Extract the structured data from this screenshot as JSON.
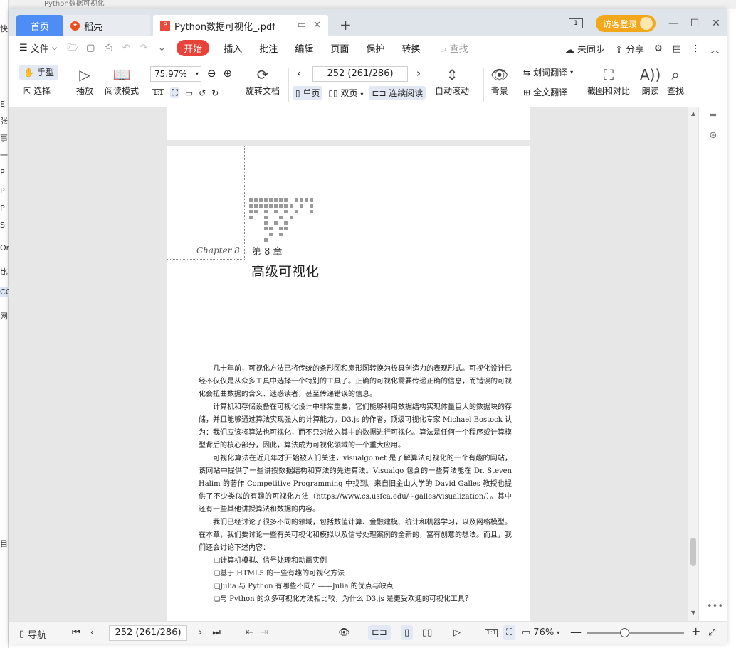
{
  "background_window": {
    "title": "Python数据可视化",
    "side_chars": [
      "快",
      "E",
      "张",
      "事",
      "一",
      "P",
      "P",
      "P",
      "S",
      "Or",
      "比",
      "CO",
      "网",
      "目"
    ]
  },
  "tabs": {
    "home": "首页",
    "docer": "稻壳",
    "pdf": "Python数据可视化_.pdf",
    "pdf_icon": "P",
    "add": "+"
  },
  "titlebar": {
    "guest_login": "访客登录",
    "pages_icon": "1"
  },
  "menu": {
    "file": "文件",
    "start": "开始",
    "items": [
      "插入",
      "批注",
      "编辑",
      "页面",
      "保护",
      "转换"
    ],
    "search": "查找",
    "unsynced": "未同步",
    "share": "分享"
  },
  "ribbon": {
    "hand": "手型",
    "select": "选择",
    "play": "播放",
    "read_mode": "阅读模式",
    "zoom": "75.97%",
    "rotate_doc": "旋转文档",
    "page_value": "252 (261/286)",
    "single_page": "单页",
    "double_page": "双页",
    "continuous": "连续阅读",
    "auto_scroll": "自动滚动",
    "background": "背景",
    "word_translate": "划词翻译",
    "full_translate": "全文翻译",
    "screenshot_compare": "截图和对比",
    "read_aloud": "朗读",
    "find": "查找",
    "actual_size": "1:1"
  },
  "document": {
    "chapter_script": "Chapter 8",
    "chapter_num": "第 8 章",
    "chapter_title": "高级可视化",
    "paragraphs": [
      "几十年前，可视化方法已将传统的条形图和扇形图转换为极具创造力的表现形式。可视化设计已经不仅仅是从众多工具中选择一个特别的工具了。正确的可视化需要传递正确的信息，而错误的可视化会扭曲数据的含义、迷惑读者，甚至传递错误的信息。",
      "计算机和存储设备在可视化设计中非常重要，它们能够利用数据结构实现体量巨大的数据块的存储，并且能够通过算法实现强大的计算能力。D3.js 的作者，顶级可视化专家 Michael Bostock 认为：我们应该将算法也可视化，而不只对放入其中的数据进行可视化。算法是任何一个程序或计算模型背后的核心部分，因此，算法成为可视化领域的一个重大应用。",
      "可视化算法在近几年才开始被人们关注，visualgo.net 是了解算法可视化的一个有趣的网站，该网站中提供了一些讲授数据结构和算法的先进算法。Visualgo 包含的一些算法能在 Dr. Steven Halim 的著作 Competitive Programming 中找到。来自旧金山大学的 David Galles 教授也提供了不少类似的有趣的可视化方法（https://www.cs.usfca.edu/~galles/visualization/）。其中还有一些其他讲授算法和数据的内容。",
      "我们已经讨论了很多不同的领域，包括数值计算、金融建模、统计和机器学习，以及网络模型。在本章，我们要讨论一些有关可视化和模拟以及信号处理案例的全新的，富有创意的想法。而且，我们还会讨论下述内容："
    ],
    "bullets": [
      "计算机模拟、信号处理和动画实例",
      "基于 HTML5 的一些有趣的可视化方法",
      "Julia 与 Python 有哪些不同？——Julia 的优点与缺点",
      "与 Python 的众多可视化方法相比较，为什么 D3.js 是更受欢迎的可视化工具？"
    ]
  },
  "statusbar": {
    "nav": "导航",
    "page_value": "252 (261/286)",
    "zoom": "76%",
    "actual_size": "1:1"
  },
  "colors": {
    "accent": "#4e8df5",
    "start_red": "#e8433a",
    "guest_orange": "#f3a81b"
  }
}
